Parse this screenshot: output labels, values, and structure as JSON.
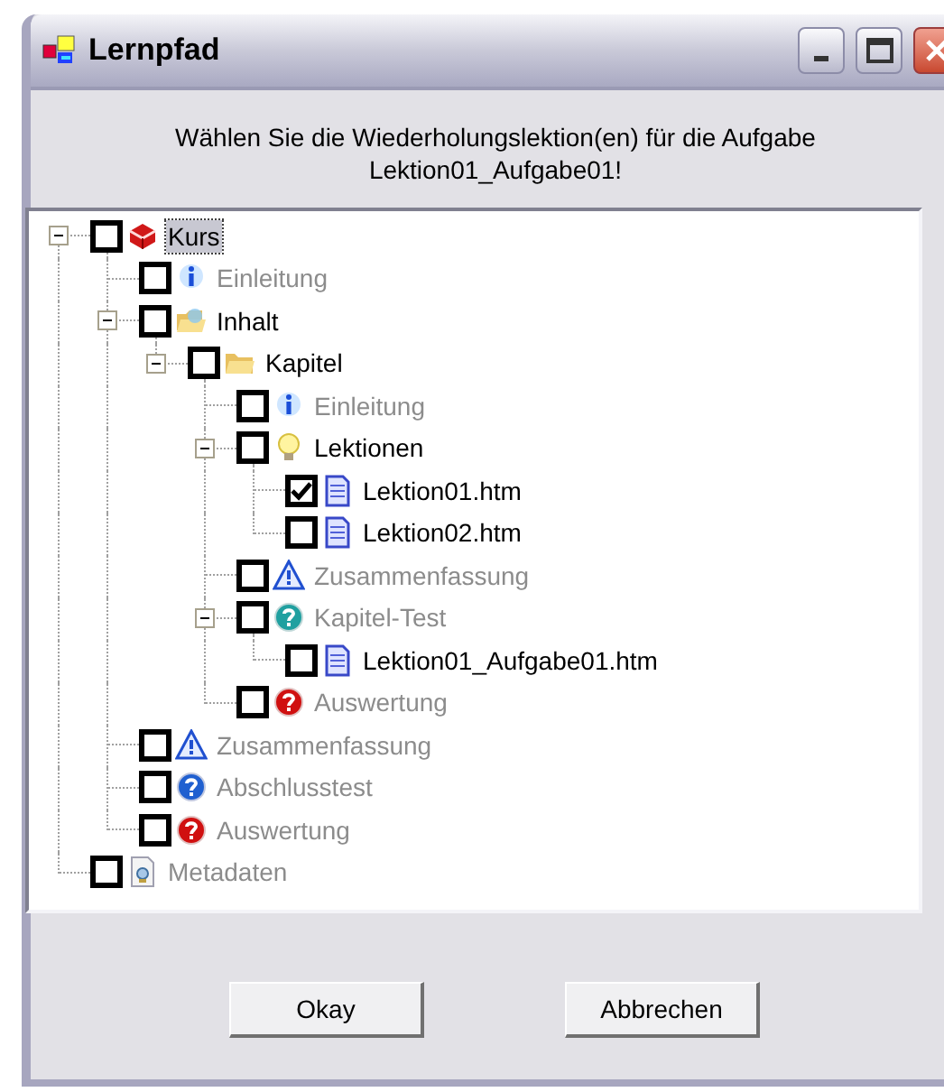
{
  "window": {
    "title": "Lernpfad"
  },
  "message_lines": [
    "Wählen Sie die Wiederholungslektion(en) für die Aufgabe",
    "Lektion01_Aufgabe01!"
  ],
  "tree": [
    {
      "label": "Kurs",
      "kind": "book",
      "checked": false,
      "disabled": false,
      "selected": true,
      "expanded": true,
      "children": [
        {
          "label": "Einleitung",
          "kind": "info",
          "checked": false,
          "disabled": true,
          "selected": false
        },
        {
          "label": "Inhalt",
          "kind": "folder_open",
          "checked": false,
          "disabled": false,
          "selected": false,
          "expanded": true,
          "children": [
            {
              "label": "Kapitel",
              "kind": "folder",
              "checked": false,
              "disabled": false,
              "selected": false,
              "expanded": true,
              "children": [
                {
                  "label": "Einleitung",
                  "kind": "info",
                  "checked": false,
                  "disabled": true,
                  "selected": false
                },
                {
                  "label": "Lektionen",
                  "kind": "bulb",
                  "checked": false,
                  "disabled": false,
                  "selected": false,
                  "expanded": true,
                  "children": [
                    {
                      "label": "Lektion01.htm",
                      "kind": "page",
                      "checked": true,
                      "disabled": false,
                      "selected": false
                    },
                    {
                      "label": "Lektion02.htm",
                      "kind": "page",
                      "checked": false,
                      "disabled": false,
                      "selected": false
                    }
                  ]
                },
                {
                  "label": "Zusammenfassung",
                  "kind": "warning",
                  "checked": false,
                  "disabled": true,
                  "selected": false
                },
                {
                  "label": "Kapitel-Test",
                  "kind": "test",
                  "checked": false,
                  "disabled": true,
                  "selected": false,
                  "expanded": true,
                  "children": [
                    {
                      "label": "Lektion01_Aufgabe01.htm",
                      "kind": "page",
                      "checked": false,
                      "disabled": false,
                      "selected": false
                    }
                  ]
                },
                {
                  "label": "Auswertung",
                  "kind": "evaluation",
                  "checked": false,
                  "disabled": true,
                  "selected": false
                }
              ]
            }
          ]
        },
        {
          "label": "Zusammenfassung",
          "kind": "warning",
          "checked": false,
          "disabled": true,
          "selected": false
        },
        {
          "label": "Abschlusstest",
          "kind": "final_test",
          "checked": false,
          "disabled": true,
          "selected": false
        },
        {
          "label": "Auswertung",
          "kind": "evaluation",
          "checked": false,
          "disabled": true,
          "selected": false
        }
      ]
    },
    {
      "label": "Metadaten",
      "kind": "metadata",
      "checked": false,
      "disabled": true,
      "selected": false
    }
  ],
  "buttons": [
    "Okay",
    "Abbrechen"
  ]
}
